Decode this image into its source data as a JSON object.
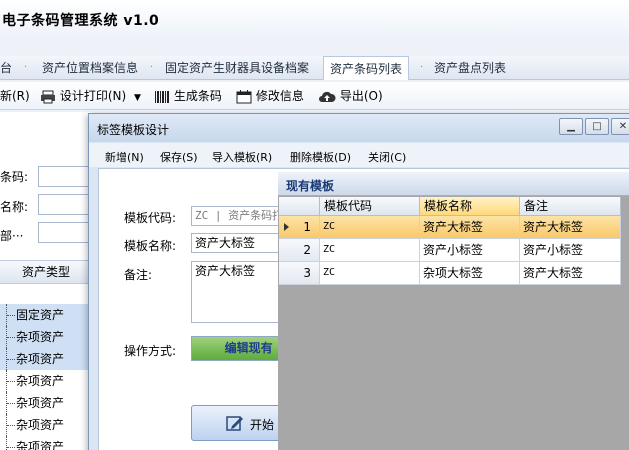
{
  "app": {
    "title": "电子条码管理系统 v1.0"
  },
  "tabs": [
    {
      "label": "台"
    },
    {
      "label": "资产位置档案信息"
    },
    {
      "label": "固定资产生财器具设备档案"
    },
    {
      "label": "资产条码列表"
    },
    {
      "label": "资产盘点列表"
    }
  ],
  "toolbar": {
    "new_label": "新(R)",
    "print_label": "设计打印(N)",
    "generate_label": "生成条码",
    "edit_label": "修改信息",
    "export_label": "导出(O)"
  },
  "left_panel": {
    "fields": [
      "条码:",
      "名称:",
      "部···"
    ],
    "column_header": "资产类型",
    "tree_items": [
      "固定资产",
      "杂项资产",
      "杂项资产",
      "杂项资产",
      "杂项资产",
      "杂项资产",
      "杂项资产"
    ]
  },
  "dialog": {
    "title": "标签模板设计",
    "menu": [
      "新增(N)",
      "保存(S)",
      "导入模板(R)",
      "删除模板(D)",
      "关闭(C)"
    ],
    "form": {
      "code_label": "模板代码:",
      "code_placeholder": "ZC | 资产条码打",
      "name_label": "模板名称:",
      "name_value": "资产大标签",
      "remark_label": "备注:",
      "remark_value": "资产大标签",
      "mode_label": "操作方式:",
      "mode_value": "编辑现有",
      "mode_progress": 0.51,
      "start_label": "开始"
    }
  },
  "templates_panel": {
    "title": "现有模板",
    "columns": [
      "模板代码",
      "模板名称",
      "备注"
    ],
    "rows": [
      {
        "num": "1",
        "code": "ZC",
        "name": "资产大标签",
        "remark": "资产大标签"
      },
      {
        "num": "2",
        "code": "ZC",
        "name": "资产小标签",
        "remark": "资产小标签"
      },
      {
        "num": "3",
        "code": "ZC",
        "name": "杂项大标签",
        "remark": "资产大标签"
      }
    ]
  }
}
